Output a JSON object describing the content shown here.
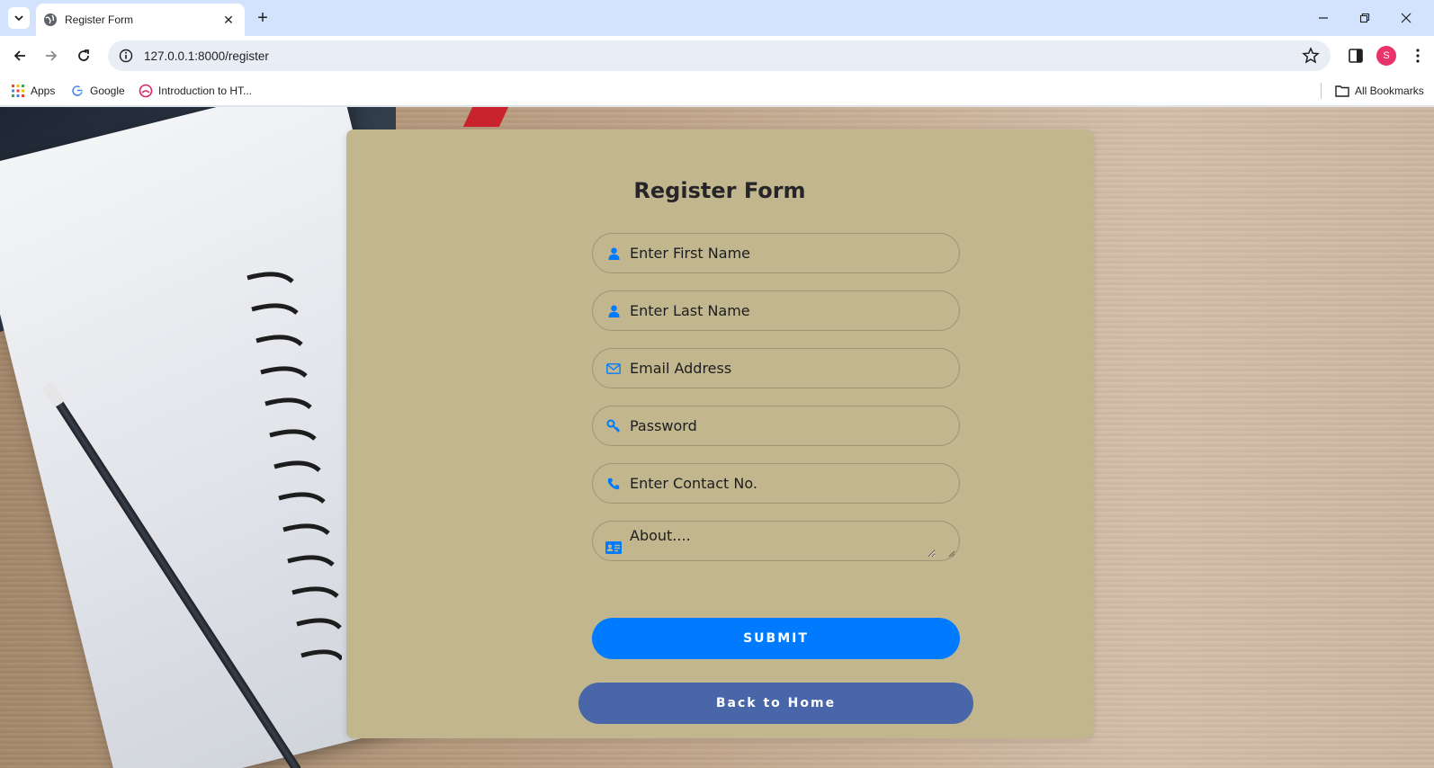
{
  "browser": {
    "tab": {
      "title": "Register Form"
    },
    "url": "127.0.0.1:8000/register",
    "profile_initial": "S",
    "bookmarks": [
      {
        "label": "Apps",
        "icon": "apps-grid-icon"
      },
      {
        "label": "Google",
        "icon": "google-icon"
      },
      {
        "label": "Introduction to HT...",
        "icon": "site-icon"
      }
    ],
    "all_bookmarks_label": "All Bookmarks"
  },
  "form": {
    "title": "Register Form",
    "fields": [
      {
        "name": "first-name",
        "placeholder": "Enter First Name",
        "icon": "user-icon"
      },
      {
        "name": "last-name",
        "placeholder": "Enter Last Name",
        "icon": "user-icon"
      },
      {
        "name": "email",
        "placeholder": "Email Address",
        "icon": "envelope-icon"
      },
      {
        "name": "password",
        "placeholder": "Password",
        "icon": "key-icon"
      },
      {
        "name": "contact",
        "placeholder": "Enter Contact No.",
        "icon": "phone-icon"
      },
      {
        "name": "about",
        "placeholder": "About....",
        "icon": "id-card-icon"
      }
    ],
    "submit_label": "SUBMIT",
    "back_label": "Back to Home"
  },
  "colors": {
    "card_background": "#c2b68e",
    "icon_accent": "#007bff",
    "submit_button": "#007bff",
    "back_button": "#4866a8"
  }
}
